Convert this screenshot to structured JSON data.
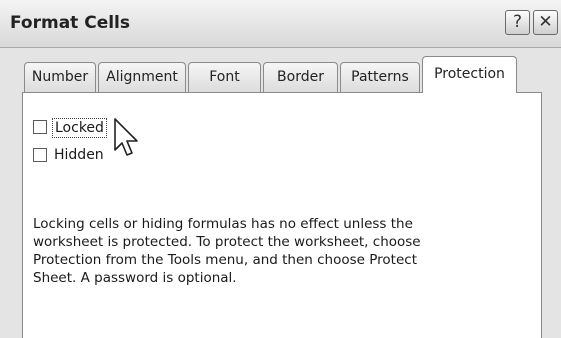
{
  "dialog": {
    "title": "Format Cells",
    "help_label": "?",
    "close_label": "✕"
  },
  "tabs": [
    {
      "label": "Number",
      "active": false
    },
    {
      "label": "Alignment",
      "active": false
    },
    {
      "label": "Font",
      "active": false
    },
    {
      "label": "Border",
      "active": false
    },
    {
      "label": "Patterns",
      "active": false
    },
    {
      "label": "Protection",
      "active": true
    }
  ],
  "protection": {
    "locked": {
      "label": "Locked",
      "checked": false
    },
    "hidden": {
      "label": "Hidden",
      "checked": false
    },
    "description": [
      "Locking cells or hiding formulas has no effect unless the",
      "worksheet is protected. To protect the worksheet, choose",
      "Protection from the Tools menu, and then choose Protect",
      "Sheet. A password is optional."
    ]
  },
  "cursor_icon": "arrow-pointer"
}
